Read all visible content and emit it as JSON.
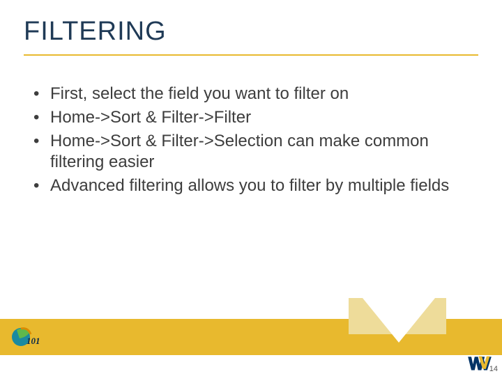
{
  "title": "FILTERING",
  "bullets": [
    "First, select the field you want to filter on",
    "Home->Sort & Filter->Filter",
    "Home->Sort & Filter->Selection can make common filtering easier",
    "Advanced filtering allows you to filter by multiple fields"
  ],
  "page_number": "14",
  "colors": {
    "title": "#1f3a56",
    "accent": "#e8b92e",
    "chevron_light": "#eedc9a",
    "wv_blue": "#003366",
    "wv_gold": "#e8b92e"
  }
}
